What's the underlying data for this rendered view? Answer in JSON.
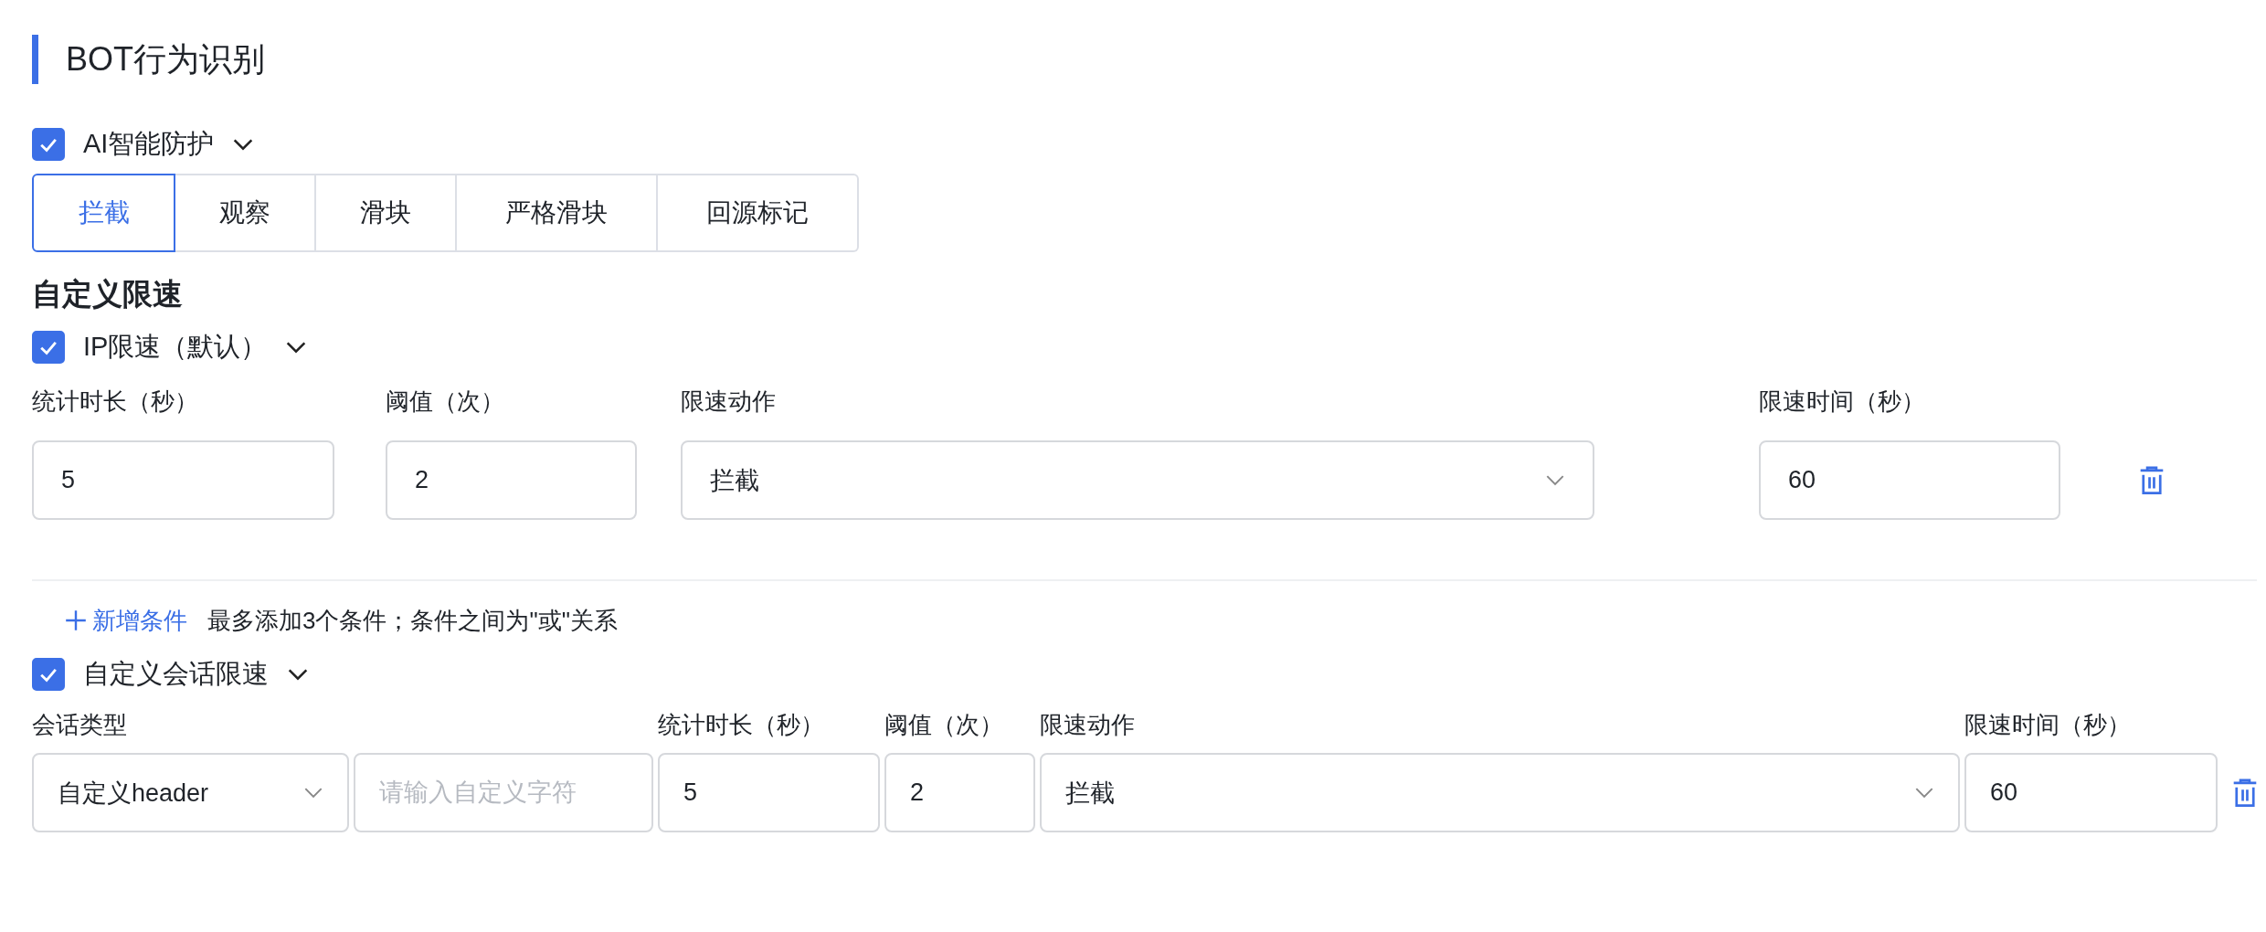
{
  "section_title": "BOT行为识别",
  "ai_protection": {
    "label": "AI智能防护",
    "checked": true
  },
  "actions": [
    {
      "label": "拦截",
      "selected": true
    },
    {
      "label": "观察",
      "selected": false
    },
    {
      "label": "滑块",
      "selected": false
    },
    {
      "label": "严格滑块",
      "selected": false
    },
    {
      "label": "回源标记",
      "selected": false
    }
  ],
  "rate_limit_title": "自定义限速",
  "ip_rate_limit": {
    "label": "IP限速（默认）",
    "checked": true,
    "columns": [
      "统计时长（秒）",
      "阈值（次）",
      "限速动作",
      "限速时间（秒）"
    ],
    "row": {
      "duration": "5",
      "threshold": "2",
      "action": "拦截",
      "limit_time": "60"
    }
  },
  "add_condition": {
    "label": "新增条件",
    "hint": "最多添加3个条件；条件之间为\"或\"关系"
  },
  "session_rate_limit": {
    "label": "自定义会话限速",
    "checked": true,
    "columns": [
      "会话类型",
      "统计时长（秒）",
      "阈值（次）",
      "限速动作",
      "限速时间（秒）"
    ],
    "row": {
      "session_type": "自定义header",
      "custom_placeholder": "请输入自定义字符",
      "duration": "5",
      "threshold": "2",
      "action": "拦截",
      "limit_time": "60"
    }
  }
}
